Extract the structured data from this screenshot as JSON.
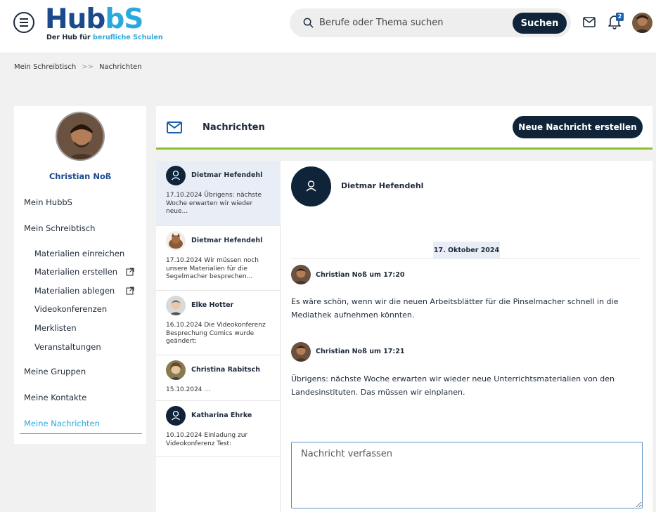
{
  "header": {
    "logo_main": "Hub",
    "logo_accent": "bS",
    "logo_tagline": "Der Hub für",
    "logo_tagline_accent": "berufliche Schulen",
    "search_placeholder": "Berufe oder Thema suchen",
    "search_button": "Suchen",
    "notification_count": "2"
  },
  "breadcrumb": {
    "items": [
      "Mein Schreibtisch",
      "Nachrichten"
    ],
    "separator": ">>"
  },
  "sidebar": {
    "profile_name": "Christian Noß",
    "items": [
      {
        "label": "Mein HubbS"
      },
      {
        "label": "Mein Schreibtisch"
      },
      {
        "label": "Materialien einreichen"
      },
      {
        "label": "Materialien erstellen",
        "external": true
      },
      {
        "label": "Materialien ablegen",
        "external": true
      },
      {
        "label": "Videokonferenzen"
      },
      {
        "label": "Merklisten"
      },
      {
        "label": "Veranstaltungen"
      },
      {
        "label": "Meine Gruppen"
      },
      {
        "label": "Meine Kontakte"
      },
      {
        "label": "Meine Nachrichten",
        "active": true
      }
    ]
  },
  "main": {
    "title": "Nachrichten",
    "new_message_button": "Neue Nachricht erstellen",
    "accent_color": "#8cbf2c"
  },
  "conversations": [
    {
      "name": "Dietmar Hefendehl",
      "preview": "17.10.2024 Übrigens: nächste Woche erwarten wir wieder neue...",
      "avatar": "user-icon",
      "active": true
    },
    {
      "name": "Dietmar Hefendehl",
      "preview": "17.10.2024 Wir müssen noch unsere Materialien für die Segelmacher besprechen...",
      "avatar": "photo"
    },
    {
      "name": "Elke Hotter",
      "preview": "16.10.2024 Die Videokonferenz Besprechung Comics wurde geändert:",
      "avatar": "photo"
    },
    {
      "name": "Christina Rabitsch",
      "preview": "15.10.2024 ...",
      "avatar": "photo"
    },
    {
      "name": "Katharina Ehrke",
      "preview": "10.10.2024 Einladung zur Videokonferenz Test:",
      "avatar": "user-icon"
    }
  ],
  "chat": {
    "partner": "Dietmar Hefendehl",
    "date_label": "17. Oktober 2024",
    "messages": [
      {
        "sender": "Christian Noß um 17:20",
        "text": "Es wäre schön, wenn wir die neuen Arbeitsblätter für die Pinselmacher schnell in die Mediathek aufnehmen könnten."
      },
      {
        "sender": "Christian Noß um 17:21",
        "text": "Übrigens: nächste Woche erwarten wir wieder neue Unterrichtsmaterialien von den Landesinstituten. Das müssen wir einplanen."
      }
    ],
    "composer_placeholder": "Nachricht verfassen"
  }
}
